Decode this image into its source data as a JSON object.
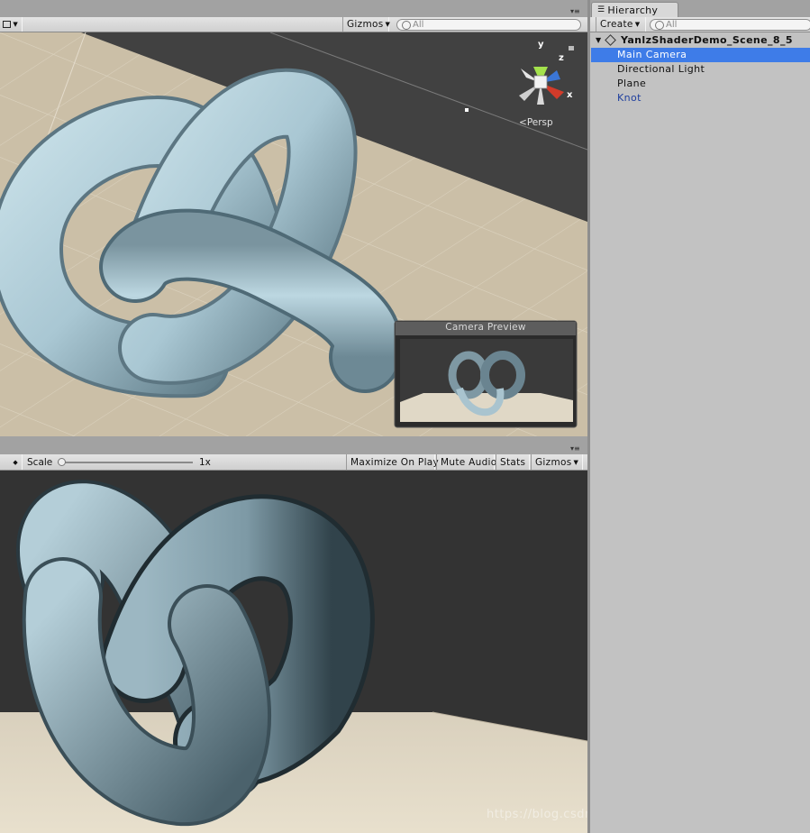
{
  "scene_toolbar": {
    "gizmos_label": "Gizmos",
    "search_placeholder": "All"
  },
  "scene_gizmo": {
    "y": "y",
    "z": "z",
    "x": "x",
    "projection": "Persp"
  },
  "camera_preview": {
    "title": "Camera Preview"
  },
  "game_toolbar": {
    "scale_label": "Scale",
    "scale_value": "1x",
    "maximize_on_play": "Maximize On Play",
    "mute_audio": "Mute Audio",
    "stats": "Stats",
    "gizmos": "Gizmos"
  },
  "hierarchy": {
    "tab_label": "Hierarchy",
    "create_label": "Create",
    "search_placeholder": "All",
    "scene_name": "YanlzShaderDemo_Scene_8_5",
    "items": [
      {
        "label": "Main Camera",
        "selected": true
      },
      {
        "label": "Directional Light",
        "selected": false
      },
      {
        "label": "Plane",
        "selected": false
      },
      {
        "label": "Knot",
        "selected": false,
        "color": "#1f3f9e"
      }
    ]
  },
  "watermark": "https://blog.csdn.net/VR_ShengLanzZ",
  "colors": {
    "selection": "#3e7ce8",
    "scene_sky": "#414141",
    "floor": "#c9bea6",
    "knot": "#a8c8d4"
  }
}
